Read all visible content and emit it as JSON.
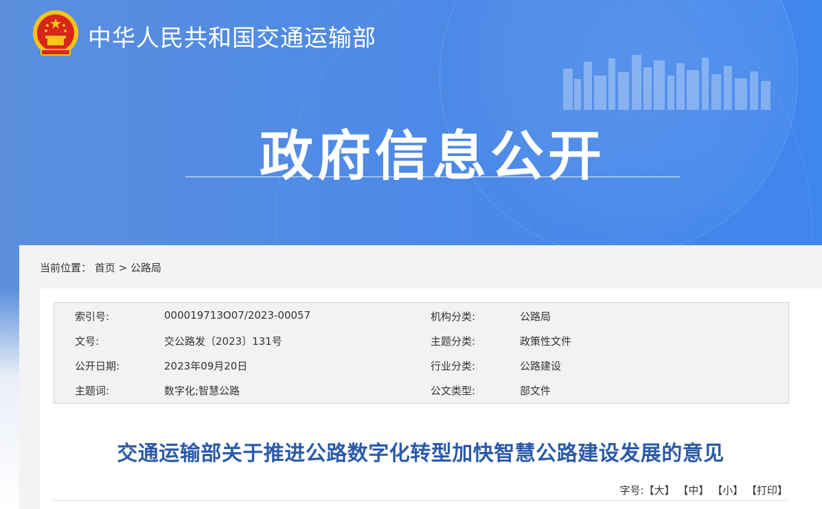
{
  "header": {
    "site_title": "中华人民共和国交通运输部",
    "banner_heading": "政府信息公开"
  },
  "breadcrumb": {
    "label": "当前位置：",
    "home": "首页",
    "separator": ">",
    "current": "公路局"
  },
  "meta": {
    "rows": [
      {
        "left_label": "索引号:",
        "left_value": "000019713O07/2023-00057",
        "right_label": "机构分类:",
        "right_value": "公路局"
      },
      {
        "left_label": "文号:",
        "left_value": "交公路发〔2023〕131号",
        "right_label": "主题分类:",
        "right_value": "政策性文件"
      },
      {
        "left_label": "公开日期:",
        "left_value": "2023年09月20日",
        "right_label": "行业分类:",
        "right_value": "公路建设"
      },
      {
        "left_label": "主题词:",
        "left_value": "数字化;智慧公路",
        "right_label": "公文类型:",
        "right_value": "部文件"
      }
    ]
  },
  "document": {
    "title": "交通运输部关于推进公路数字化转型加快智慧公路建设发展的意见"
  },
  "font_tools": {
    "label": "字号:",
    "large": "【大】",
    "medium": "【中】",
    "small": "【小】",
    "print": "【打印】"
  },
  "colors": {
    "banner_blue": "#4f8ae6",
    "title_blue": "#2b5aa8",
    "emblem_red": "#d9251c",
    "emblem_gold": "#f5c518"
  }
}
